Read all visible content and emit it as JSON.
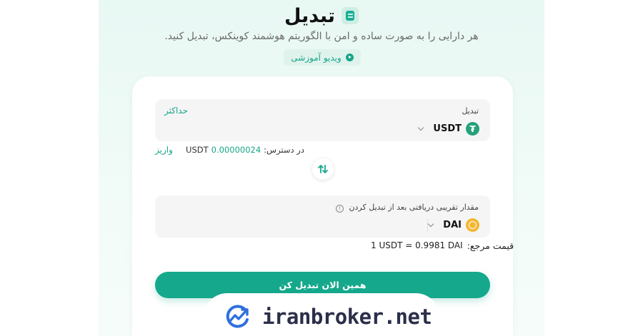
{
  "header": {
    "title": "تبدیل",
    "subtitle": "هر دارایی را به صورت ساده و امن با الگوریتم هوشمند کوینکس، تبدیل کنید.",
    "video_button": "ویدیو آموزشی"
  },
  "from": {
    "label": "تبدیل",
    "max_label": "حداکثر",
    "asset": "USDT",
    "coin_glyph": "₮",
    "available_label": "در دسترس:",
    "available_amount": "0.00000024",
    "available_unit": "USDT",
    "deposit_label": "واریز"
  },
  "to": {
    "label": "مقدار تقریبی دریافتی بعد از تبدیل کردن",
    "info_glyph": "!",
    "asset": "DAI"
  },
  "rate": {
    "label": "قیمت مرجع:",
    "value": "1 USDT = 0.9981 DAI"
  },
  "action": {
    "convert_label": "همین الان تبدیل کن"
  },
  "watermark": {
    "text": "iranbroker.net"
  },
  "colors": {
    "accent": "#15a88c",
    "usdt": "#26a17b",
    "dai": "#f4b731"
  }
}
